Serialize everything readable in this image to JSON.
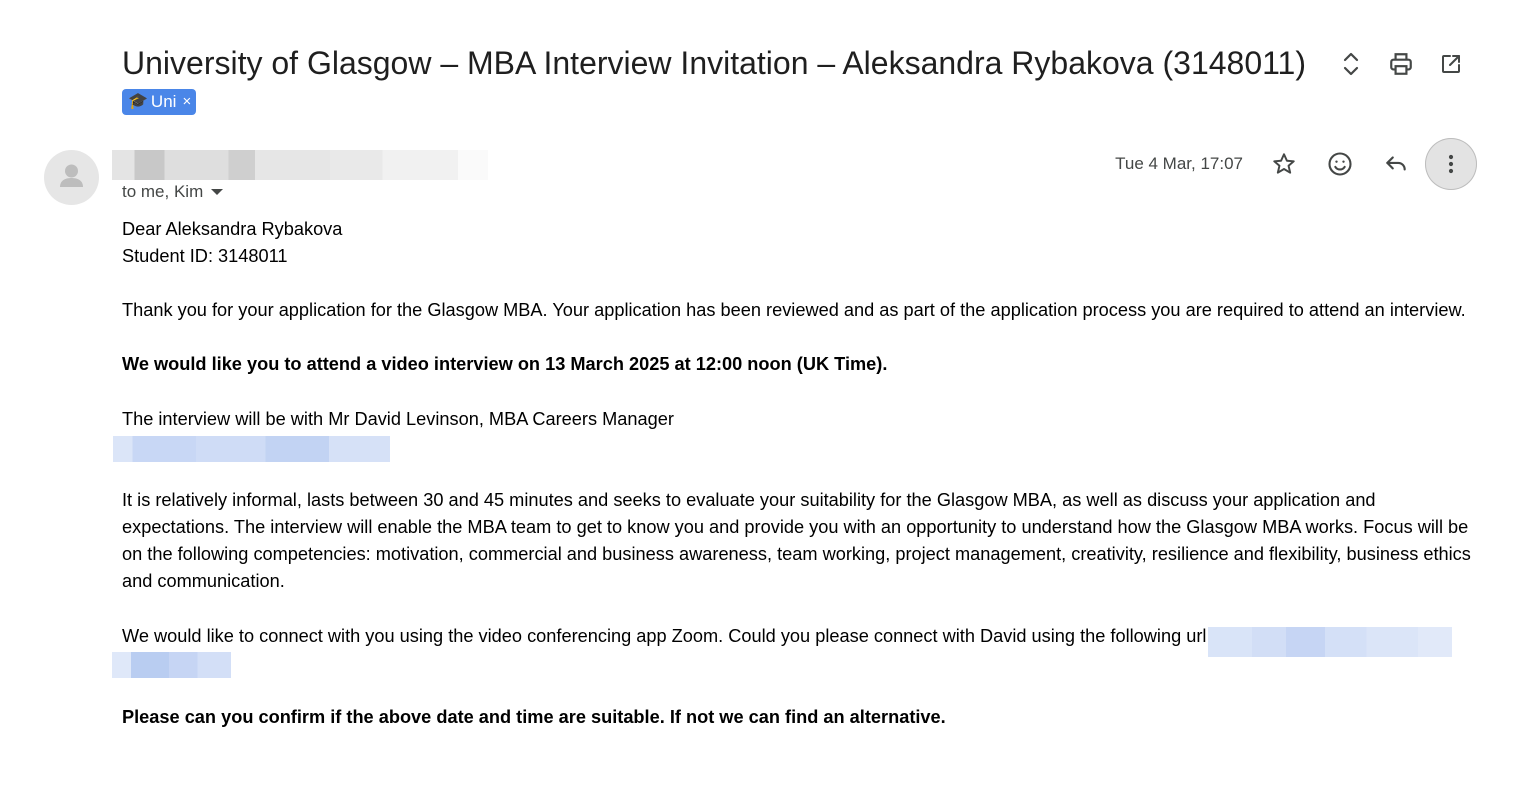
{
  "email": {
    "subject": "University of Glasgow – MBA Interview Invitation – Aleksandra Rybakova (3148011)",
    "label": {
      "icon": "graduation-cap-icon",
      "emoji": "🎓",
      "text": "Uni",
      "remove": "×",
      "color": "#4a86e8"
    },
    "recipients": "to me, Kim",
    "date": "Tue 4 Mar, 17:07",
    "body": {
      "salutation": "Dear Aleksandra Rybakova",
      "student_id": "Student ID: 3148011",
      "p1": "Thank you for your application for the Glasgow MBA. Your application has been reviewed and as part of the application process you are required to attend an interview.",
      "p2": "We would like you to attend a video interview on 13 March 2025 at 12:00 noon (UK Time).",
      "p3": "The interview will be with Mr David Levinson, MBA Careers Manager",
      "p4": "It is relatively informal, lasts between 30 and 45 minutes and seeks to evaluate your suitability for the Glasgow MBA, as well as discuss your application and expectations. The interview will enable the MBA team to get to know you and provide you with an opportunity to understand how the Glasgow MBA works. Focus will be on the following competencies: motivation, commercial and business awareness, team working, project management, creativity, resilience and flexibility, business ethics and communication.",
      "p5": "We would like to connect with you using the video conferencing app Zoom. Could you please connect with David using the following url:",
      "p6": "Please can you confirm if the above date and time are suitable. If not we can find an alternative."
    }
  },
  "toolbar_icons": [
    "expand-collapse-icon",
    "print-icon",
    "open-in-new-window-icon"
  ],
  "message_action_icons": [
    "star-icon",
    "emoji-reaction-icon",
    "reply-icon",
    "more-options-icon"
  ],
  "colors": {
    "label": "#4a86e8",
    "meta_text": "#444746",
    "body_text": "#000000"
  }
}
